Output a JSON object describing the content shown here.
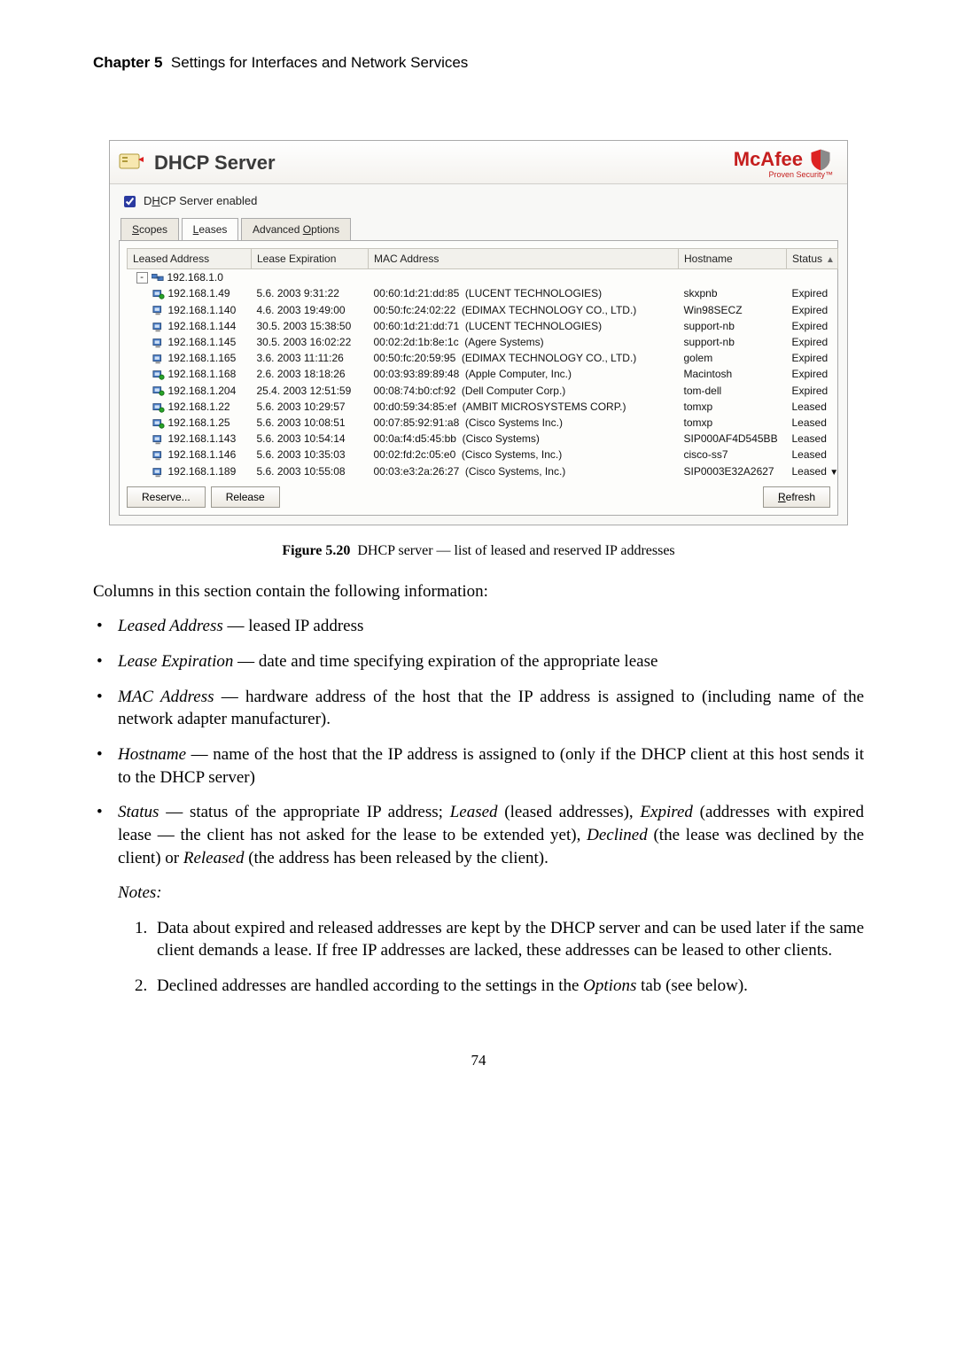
{
  "running_head": {
    "chapter": "Chapter 5",
    "title": "Settings for Interfaces and Network Services"
  },
  "dhcp_window": {
    "title": "DHCP Server",
    "logo_text": "McAfee",
    "logo_sub": "Proven Security™",
    "enabled_checkbox_label_pre": "D",
    "enabled_checkbox_label_u": "H",
    "enabled_checkbox_label_post": "CP Server enabled",
    "tabs": {
      "scopes_u": "S",
      "scopes_rest": "copes",
      "leases_u": "L",
      "leases_rest": "eases",
      "advopt_pre": "Advanced ",
      "advopt_u": "O",
      "advopt_post": "ptions"
    },
    "columns": {
      "leased_address": "Leased Address",
      "lease_expiration": "Lease Expiration",
      "mac_address": "MAC Address",
      "hostname": "Hostname",
      "status": "Status"
    },
    "root_node": "192.168.1.0",
    "rows": [
      {
        "ip": "192.168.1.49",
        "exp": "5.6. 2003 9:31:22",
        "mac": "00:60:1d:21:dd:85",
        "vendor": "(LUCENT TECHNOLOGIES)",
        "host": "skxpnb",
        "status": "Expired",
        "icon": "reserved"
      },
      {
        "ip": "192.168.1.140",
        "exp": "4.6. 2003 19:49:00",
        "mac": "00:50:fc:24:02:22",
        "vendor": "(EDIMAX TECHNOLOGY CO., LTD.)",
        "host": "Win98SECZ",
        "status": "Expired",
        "icon": "pc"
      },
      {
        "ip": "192.168.1.144",
        "exp": "30.5. 2003 15:38:50",
        "mac": "00:60:1d:21:dd:71",
        "vendor": "(LUCENT TECHNOLOGIES)",
        "host": "support-nb",
        "status": "Expired",
        "icon": "pc"
      },
      {
        "ip": "192.168.1.145",
        "exp": "30.5. 2003 16:02:22",
        "mac": "00:02:2d:1b:8e:1c",
        "vendor": "(Agere Systems)",
        "host": "support-nb",
        "status": "Expired",
        "icon": "pc"
      },
      {
        "ip": "192.168.1.165",
        "exp": "3.6. 2003 11:11:26",
        "mac": "00:50:fc:20:59:95",
        "vendor": "(EDIMAX TECHNOLOGY CO., LTD.)",
        "host": "golem",
        "status": "Expired",
        "icon": "pc"
      },
      {
        "ip": "192.168.1.168",
        "exp": "2.6. 2003 18:18:26",
        "mac": "00:03:93:89:89:48",
        "vendor": "(Apple Computer, Inc.)",
        "host": "Macintosh",
        "status": "Expired",
        "icon": "reserved"
      },
      {
        "ip": "192.168.1.204",
        "exp": "25.4. 2003 12:51:59",
        "mac": "00:08:74:b0:cf:92",
        "vendor": "(Dell Computer Corp.)",
        "host": "tom-dell",
        "status": "Expired",
        "icon": "reserved"
      },
      {
        "ip": "192.168.1.22",
        "exp": "5.6. 2003 10:29:57",
        "mac": "00:d0:59:34:85:ef",
        "vendor": "(AMBIT MICROSYSTEMS CORP.)",
        "host": "tomxp",
        "status": "Leased",
        "icon": "reserved"
      },
      {
        "ip": "192.168.1.25",
        "exp": "5.6. 2003 10:08:51",
        "mac": "00:07:85:92:91:a8",
        "vendor": "(Cisco Systems Inc.)",
        "host": "tomxp",
        "status": "Leased",
        "icon": "reserved"
      },
      {
        "ip": "192.168.1.143",
        "exp": "5.6. 2003 10:54:14",
        "mac": "00:0a:f4:d5:45:bb",
        "vendor": "(Cisco Systems)",
        "host": "SIP000AF4D545BB",
        "status": "Leased",
        "icon": "pc"
      },
      {
        "ip": "192.168.1.146",
        "exp": "5.6. 2003 10:35:03",
        "mac": "00:02:fd:2c:05:e0",
        "vendor": "(Cisco Systems, Inc.)",
        "host": "cisco-ss7",
        "status": "Leased",
        "icon": "pc"
      },
      {
        "ip": "192.168.1.189",
        "exp": "5.6. 2003 10:55:08",
        "mac": "00:03:e3:2a:26:27",
        "vendor": "(Cisco Systems, Inc.)",
        "host": "SIP0003E32A2627",
        "status": "Leased",
        "icon": "pc"
      }
    ],
    "buttons": {
      "reserve": "Reserve...",
      "release": "Release",
      "refresh_u": "R",
      "refresh_rest": "efresh"
    }
  },
  "caption": {
    "label": "Figure 5.20",
    "text": "DHCP server — list of leased and reserved IP addresses"
  },
  "intro": "Columns in this section contain the following information:",
  "bullets": {
    "b1": {
      "term": "Leased Address",
      "desc": " — leased IP address"
    },
    "b2": {
      "term": "Lease Expiration",
      "desc": " — date and time specifying expiration of the appropriate lease"
    },
    "b3": {
      "term": "MAC Address",
      "desc": " — hardware address of the host that the IP address is assigned to (including name of the network adapter manufacturer)."
    },
    "b4": {
      "term": "Hostname",
      "desc": " — name of the host that the IP address is assigned to (only if the DHCP client at this host sends it to the DHCP server)"
    },
    "b5": {
      "term": "Status",
      "desc_a": " — status of the appropriate IP address; ",
      "leased_i": "Leased",
      "leased_p": " (leased addresses), ",
      "expired_i": "Expired",
      "expired_p": " (addresses with expired lease — the client has not asked for the lease to be extended yet), ",
      "declined_i": "Declined",
      "declined_p": " (the lease was declined by the client) or ",
      "released_i": "Released",
      "released_p": " (the address has been released by the client)."
    }
  },
  "notes_label": "Notes:",
  "notes": {
    "n1": "Data about expired and released addresses are kept by the DHCP server and can be used later if the same client demands a lease. If free IP addresses are lacked, these addresses can be leased to other clients.",
    "n2_a": "Declined addresses are handled according to the settings in the ",
    "n2_i": "Options",
    "n2_b": " tab (see below)."
  },
  "page_number": "74"
}
